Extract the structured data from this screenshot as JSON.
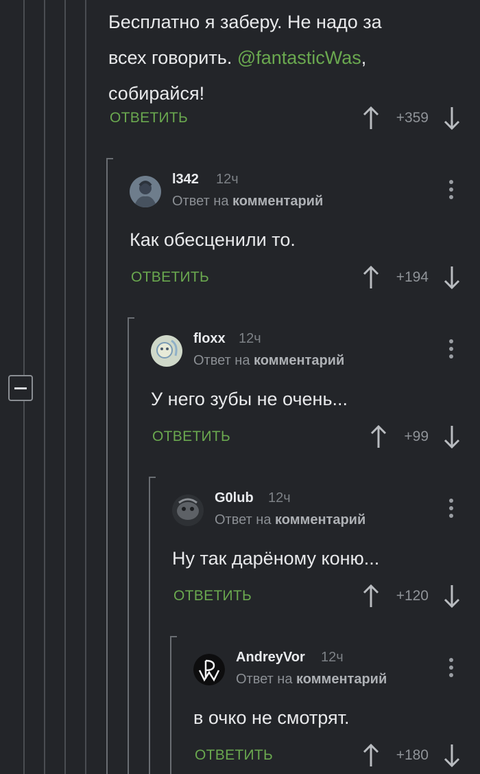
{
  "tree": {
    "collapse_label": "−"
  },
  "comments": [
    {
      "body_parts": [
        "Бесплатно я заберу. Не надо за",
        "всех говорить. ",
        "@fantasticWas",
        ",",
        "собирайся!"
      ],
      "reply_label": "ОТВЕТИТЬ",
      "score": "+359"
    },
    {
      "author": "l342",
      "time": "12ч",
      "reply_to_prefix": "Ответ на ",
      "reply_to_target": "комментарий",
      "body": "Как обесценили то.",
      "reply_label": "ОТВЕТИТЬ",
      "score": "+194"
    },
    {
      "author": "floxx",
      "time": "12ч",
      "reply_to_prefix": "Ответ на ",
      "reply_to_target": "комментарий",
      "body": "У него зубы не очень...",
      "reply_label": "ОТВЕТИТЬ",
      "score": "+99"
    },
    {
      "author": "G0lub",
      "time": "12ч",
      "reply_to_prefix": "Ответ на ",
      "reply_to_target": "комментарий",
      "body": "Ну так дарёному коню...",
      "reply_label": "ОТВЕТИТЬ",
      "score": "+120"
    },
    {
      "author": "AndreyVor",
      "time": "12ч",
      "reply_to_prefix": "Ответ на ",
      "reply_to_target": "комментарий",
      "body": "в очко не смотрят.",
      "reply_label": "ОТВЕТИТЬ",
      "score": "+180"
    }
  ],
  "colors": {
    "background": "#232529",
    "accent": "#6aa84f",
    "thread_line": "#4a4d52"
  }
}
